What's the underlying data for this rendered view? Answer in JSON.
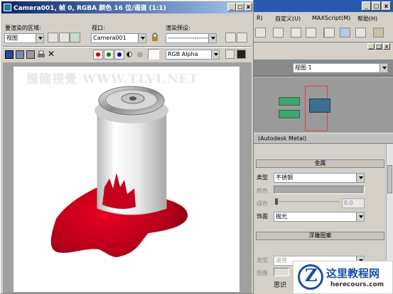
{
  "window": {
    "title": "Camera001, 帧 0, RGBA 颜色 16 位/通道 (1:1)",
    "controls": [
      "_",
      "□",
      "X"
    ]
  },
  "render_area": {
    "label": "要渲染的区域:",
    "value": "视图"
  },
  "viewport": {
    "label": "视口:",
    "value": "Camera001"
  },
  "preset": {
    "label": "渲染预设:",
    "value": "--------------------"
  },
  "channel": {
    "value": "RGB Alpha"
  },
  "watermark": "騰龍視覺 WWW.TLVI.NET",
  "menubar": {
    "items": [
      "R)",
      "自定义(U)",
      "MAXScript(M)",
      "帮助(H)"
    ]
  },
  "right_panel": {
    "view_value": "视图 1",
    "material_title": "(Autodesk Metal)",
    "metal_section": "金属",
    "type_label": "类型",
    "type_value": "不锈钢",
    "color_label": "颜色",
    "weather_label": "绿色",
    "weather_value": "0.0",
    "finish_label": "饰面",
    "finish_value": "抛光",
    "relief_section": "浮雕图案",
    "relief_type_label": "类型",
    "relief_type_value": "滚花",
    "relief_image_label": "图像",
    "status_text": "思识"
  },
  "logo": {
    "title": "这里教程网",
    "url": "herecours.com"
  },
  "colors": {
    "titlebar": "#0a246a",
    "render_bg": "#ffffff",
    "blood": "#b2001a",
    "panel_bg": "#d4d0c8",
    "swatch_green": "#3fa56e",
    "swatch_blue": "#3d6e8f"
  }
}
